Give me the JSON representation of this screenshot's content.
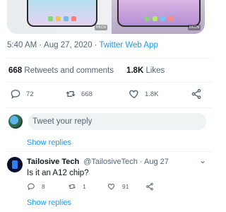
{
  "media": {
    "watermark_left": "HKCN",
    "watermark_right": "HKCN",
    "dock_colors_left": [
      "#8bd17c",
      "#f5c542",
      "#7ab6f2",
      "#ff7b7b"
    ],
    "dock_colors_right": [
      "#8bd17c",
      "#b7e86a",
      "#6fc8f5",
      "#f38e8e"
    ]
  },
  "tweet": {
    "time": "5:40 AM",
    "date": "Aug 27, 2020",
    "separator_1": "·",
    "separator_2": "·",
    "source": "Twitter Web App",
    "retweets_and_comments_count": "668",
    "retweets_and_comments_label": "Retweets and comments",
    "likes_count": "1.8K",
    "likes_label": "Likes",
    "actions": {
      "reply_count": "72",
      "retweet_count": "668",
      "like_count": "1.8K"
    }
  },
  "composer": {
    "placeholder": "Tweet your reply"
  },
  "show_replies_1": "Show replies",
  "reply": {
    "name": "Tailosive Tech",
    "handle": "@TailosiveTech",
    "separator": "·",
    "date": "Aug 27",
    "more": "⌄",
    "text": "Is it an A12 chip?",
    "actions": {
      "reply_count": "8",
      "retweet_count": "1",
      "like_count": "91"
    }
  },
  "show_replies_2": "Show replies",
  "colors": {
    "accent": "#1d9bf0",
    "secondary_text": "#536471",
    "primary_text": "#0f1419",
    "divider": "#eff3f4"
  }
}
